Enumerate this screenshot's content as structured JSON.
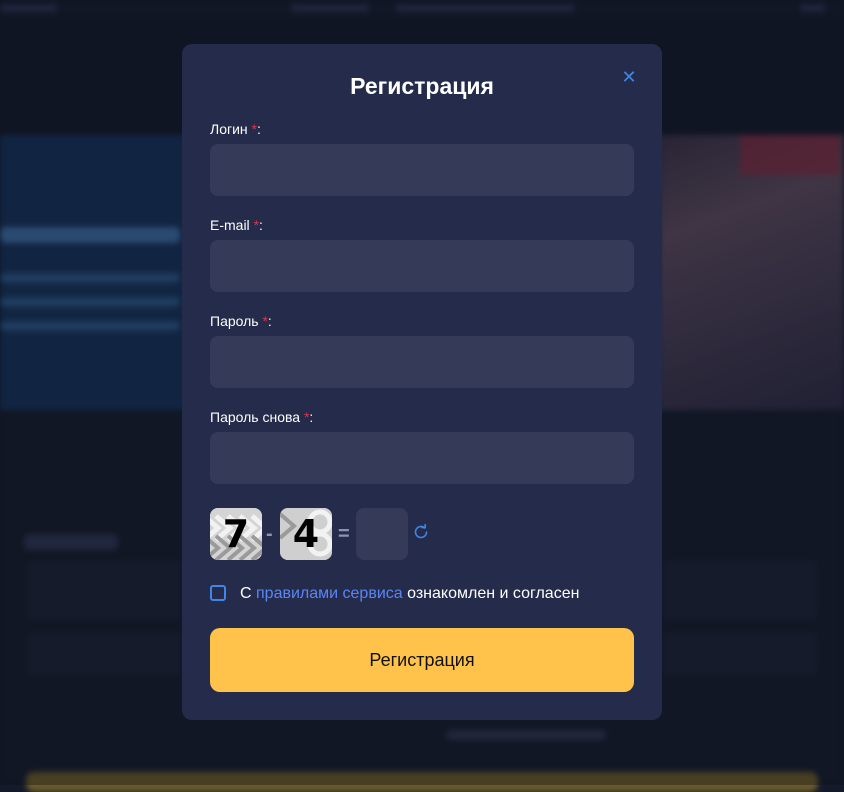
{
  "modal": {
    "title": "Регистрация",
    "close_icon": "close-icon",
    "fields": {
      "login": {
        "label": "Логин",
        "required_mark": "*",
        "suffix": ":",
        "value": ""
      },
      "email": {
        "label": "E-mail",
        "required_mark": "*",
        "suffix": ":",
        "value": ""
      },
      "password": {
        "label": "Пароль",
        "required_mark": "*",
        "suffix": ":",
        "value": ""
      },
      "password_repeat": {
        "label": "Пароль снова",
        "required_mark": "*",
        "suffix": ":",
        "value": ""
      }
    },
    "captcha": {
      "first_digit": "7",
      "operator": "-",
      "second_digit": "4",
      "equals": "=",
      "answer": "",
      "refresh_icon": "refresh-icon"
    },
    "agreement": {
      "prefix": "С",
      "link_text": "правилами сервиса",
      "suffix": "ознакомлен и согласен",
      "checked": false
    },
    "submit_label": "Регистрация"
  },
  "colors": {
    "modal_bg": "#252b4a",
    "input_bg": "#343a58",
    "accent_blue": "#3f86e8",
    "link": "#5a86f5",
    "required": "#e0334a",
    "submit_bg": "#ffc24a"
  }
}
